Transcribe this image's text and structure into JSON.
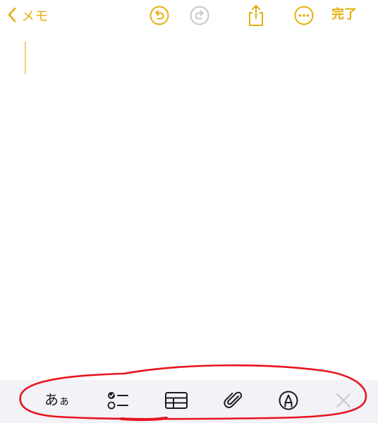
{
  "nav": {
    "back_label": "メモ",
    "done_label": "完了",
    "icons": {
      "back": "chevron-left-icon",
      "undo": "undo-icon",
      "redo": "redo-icon",
      "share": "share-icon",
      "more": "ellipsis-circle-icon"
    }
  },
  "toolbar": {
    "format_label_large": "あ",
    "format_label_small": "ぁ",
    "icons": {
      "checklist": "checklist-icon",
      "table": "table-icon",
      "attachment": "paperclip-icon",
      "markup": "pen-circle-icon",
      "close": "close-icon"
    }
  },
  "colors": {
    "accent": "#e4af0a",
    "disabled": "#c7c7cc",
    "toolbar_bg": "#f2f2f7",
    "toolbar_icon": "#1c1c1e",
    "annotation": "#e8141e"
  }
}
